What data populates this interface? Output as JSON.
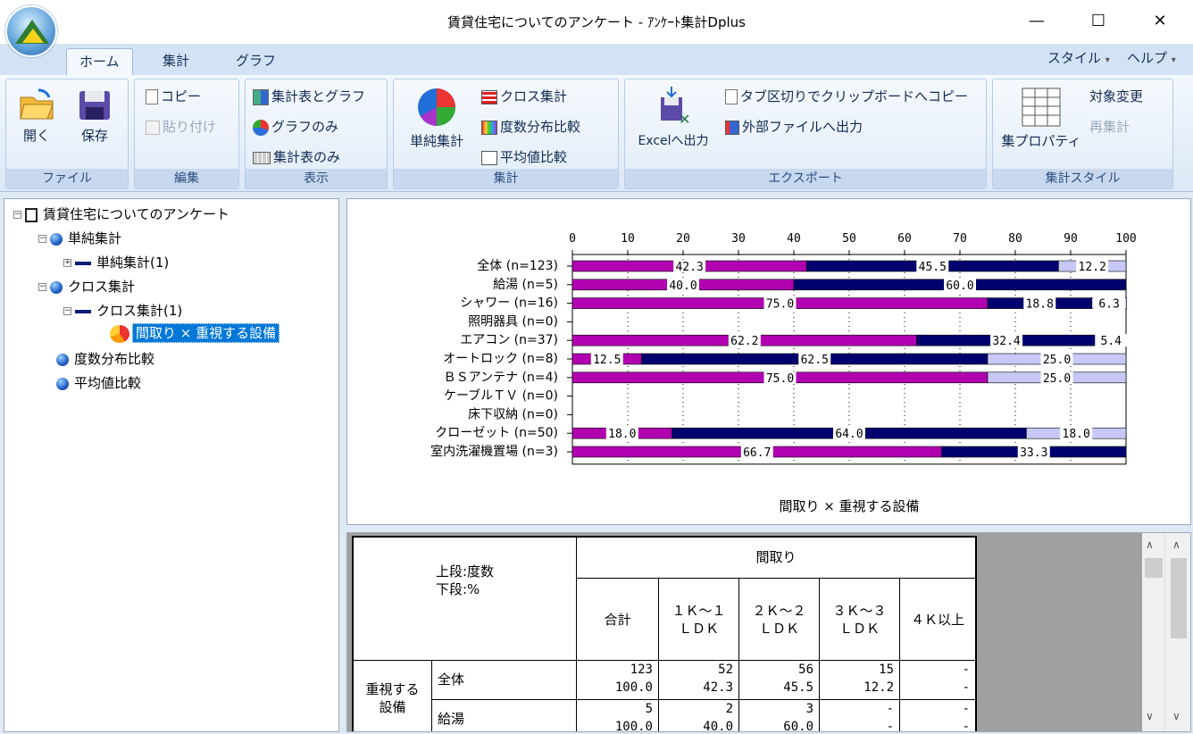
{
  "window": {
    "title": "賃貸住宅についてのアンケート - ｱﾝｹｰﾄ集計Dplus",
    "minimize": "—",
    "maximize": "☐",
    "close": "✕"
  },
  "tabs": [
    "ホーム",
    "集計",
    "グラフ"
  ],
  "right_menu": {
    "style": "スタイル",
    "help": "ヘルプ",
    "arrow": "▾"
  },
  "ribbon": {
    "file": {
      "label": "ファイル",
      "open": "開く",
      "save": "保存"
    },
    "edit": {
      "label": "編集",
      "copy": "コピー",
      "paste": "貼り付け"
    },
    "view": {
      "label": "表示",
      "table_graph": "集計表とグラフ",
      "graph_only": "グラフのみ",
      "table_only": "集計表のみ"
    },
    "agg": {
      "label": "集計",
      "simple": "単純集計",
      "cross": "クロス集計",
      "freq": "度数分布比較",
      "mean": "平均値比較"
    },
    "export": {
      "label": "エクスポート",
      "excel": "Excelへ出力",
      "clipboard": "タブ区切りでクリップボードへコピー",
      "external": "外部ファイルへ出力"
    },
    "style": {
      "label": "集計スタイル",
      "props": "集プロパティ",
      "change": "対象変更",
      "recalc": "再集計"
    }
  },
  "tree": {
    "root": "賃貸住宅についてのアンケート",
    "simple": "単純集計",
    "simple1": "単純集計(1)",
    "cross": "クロス集計",
    "cross1": "クロス集計(1)",
    "selected": "間取り × 重視する設備",
    "freq": "度数分布比較",
    "mean": "平均値比較"
  },
  "chart_data": {
    "type": "bar",
    "stacked": true,
    "orientation": "horizontal",
    "title": "間取り × 重視する設備",
    "xlim": [
      0,
      100
    ],
    "xticks": [
      0,
      10,
      20,
      30,
      40,
      50,
      60,
      70,
      80,
      90,
      100
    ],
    "categories": [
      "全体 (n=123)",
      "給湯 (n=5)",
      "シャワー (n=16)",
      "照明器具 (n=0)",
      "エアコン (n=37)",
      "オートロック (n=8)",
      "ＢＳアンテナ (n=4)",
      "ケーブルＴＶ (n=0)",
      "床下収納 (n=0)",
      "クローゼット (n=50)",
      "室内洗濯機置場 (n=3)"
    ],
    "series": [
      {
        "color": "#b000b0",
        "values": [
          42.3,
          40.0,
          75.0,
          0,
          62.2,
          12.5,
          75.0,
          0,
          0,
          18.0,
          66.7
        ]
      },
      {
        "color": "#00006e",
        "values": [
          45.5,
          60.0,
          18.8,
          0,
          32.4,
          62.5,
          0,
          0,
          0,
          64.0,
          33.3
        ]
      },
      {
        "color": "#c8c8f8",
        "values": [
          12.2,
          0,
          6.3,
          0,
          5.4,
          25.0,
          25.0,
          0,
          0,
          18.0,
          0
        ]
      }
    ]
  },
  "table": {
    "corner1": "上段:度数",
    "corner2": "下段:%",
    "group_header": "間取り",
    "columns": [
      "合計",
      "１Ｋ～１\nＬＤＫ",
      "２Ｋ～２\nＬＤＫ",
      "３Ｋ～３\nＬＤＫ",
      "４Ｋ以上"
    ],
    "row_group": "重視する\n設備",
    "rows": [
      {
        "label": "全体",
        "counts": [
          "123",
          "52",
          "56",
          "15",
          "-"
        ],
        "pcts": [
          "100.0",
          "42.3",
          "45.5",
          "12.2",
          "-"
        ]
      },
      {
        "label": "給湯",
        "counts": [
          "5",
          "2",
          "3",
          "-",
          "-"
        ],
        "pcts": [
          "100.0",
          "40.0",
          "60.0",
          "-",
          "-"
        ]
      }
    ]
  }
}
